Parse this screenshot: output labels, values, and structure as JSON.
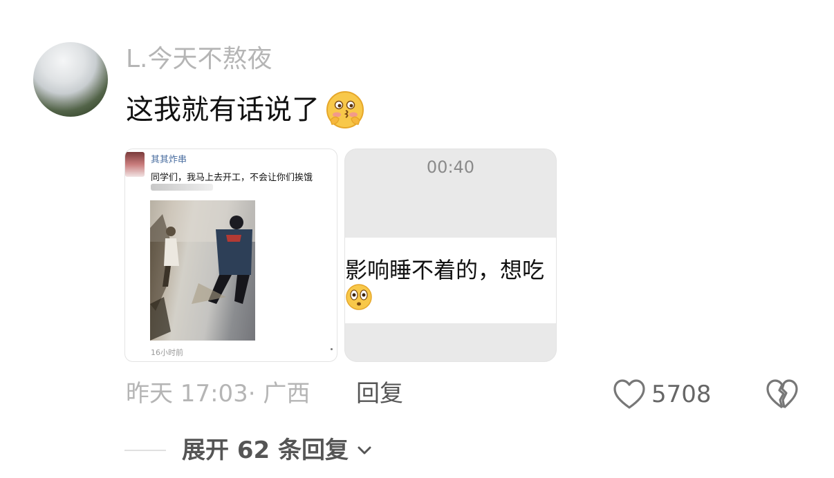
{
  "comment": {
    "username": "L.今天不熬夜",
    "text": "这我就有话说了",
    "emoji_icon": "blushing-face-emoji",
    "timestamp": "昨天 17:03·",
    "location": "广西",
    "reply_label": "回复",
    "like_count": "5708",
    "expand_label": "展开 62 条回复"
  },
  "attachment1": {
    "author": "其其炸串",
    "text": "同学们，我马上去开工，不会让你们挨饿",
    "time": "16小时前"
  },
  "attachment2": {
    "timer": "00:40",
    "text": "影响睡不着的，想吃",
    "emoji_icon": "surprised-eyes-emoji"
  },
  "colors": {
    "muted": "#b5b5b5",
    "text": "#111111",
    "secondary": "#555555"
  }
}
